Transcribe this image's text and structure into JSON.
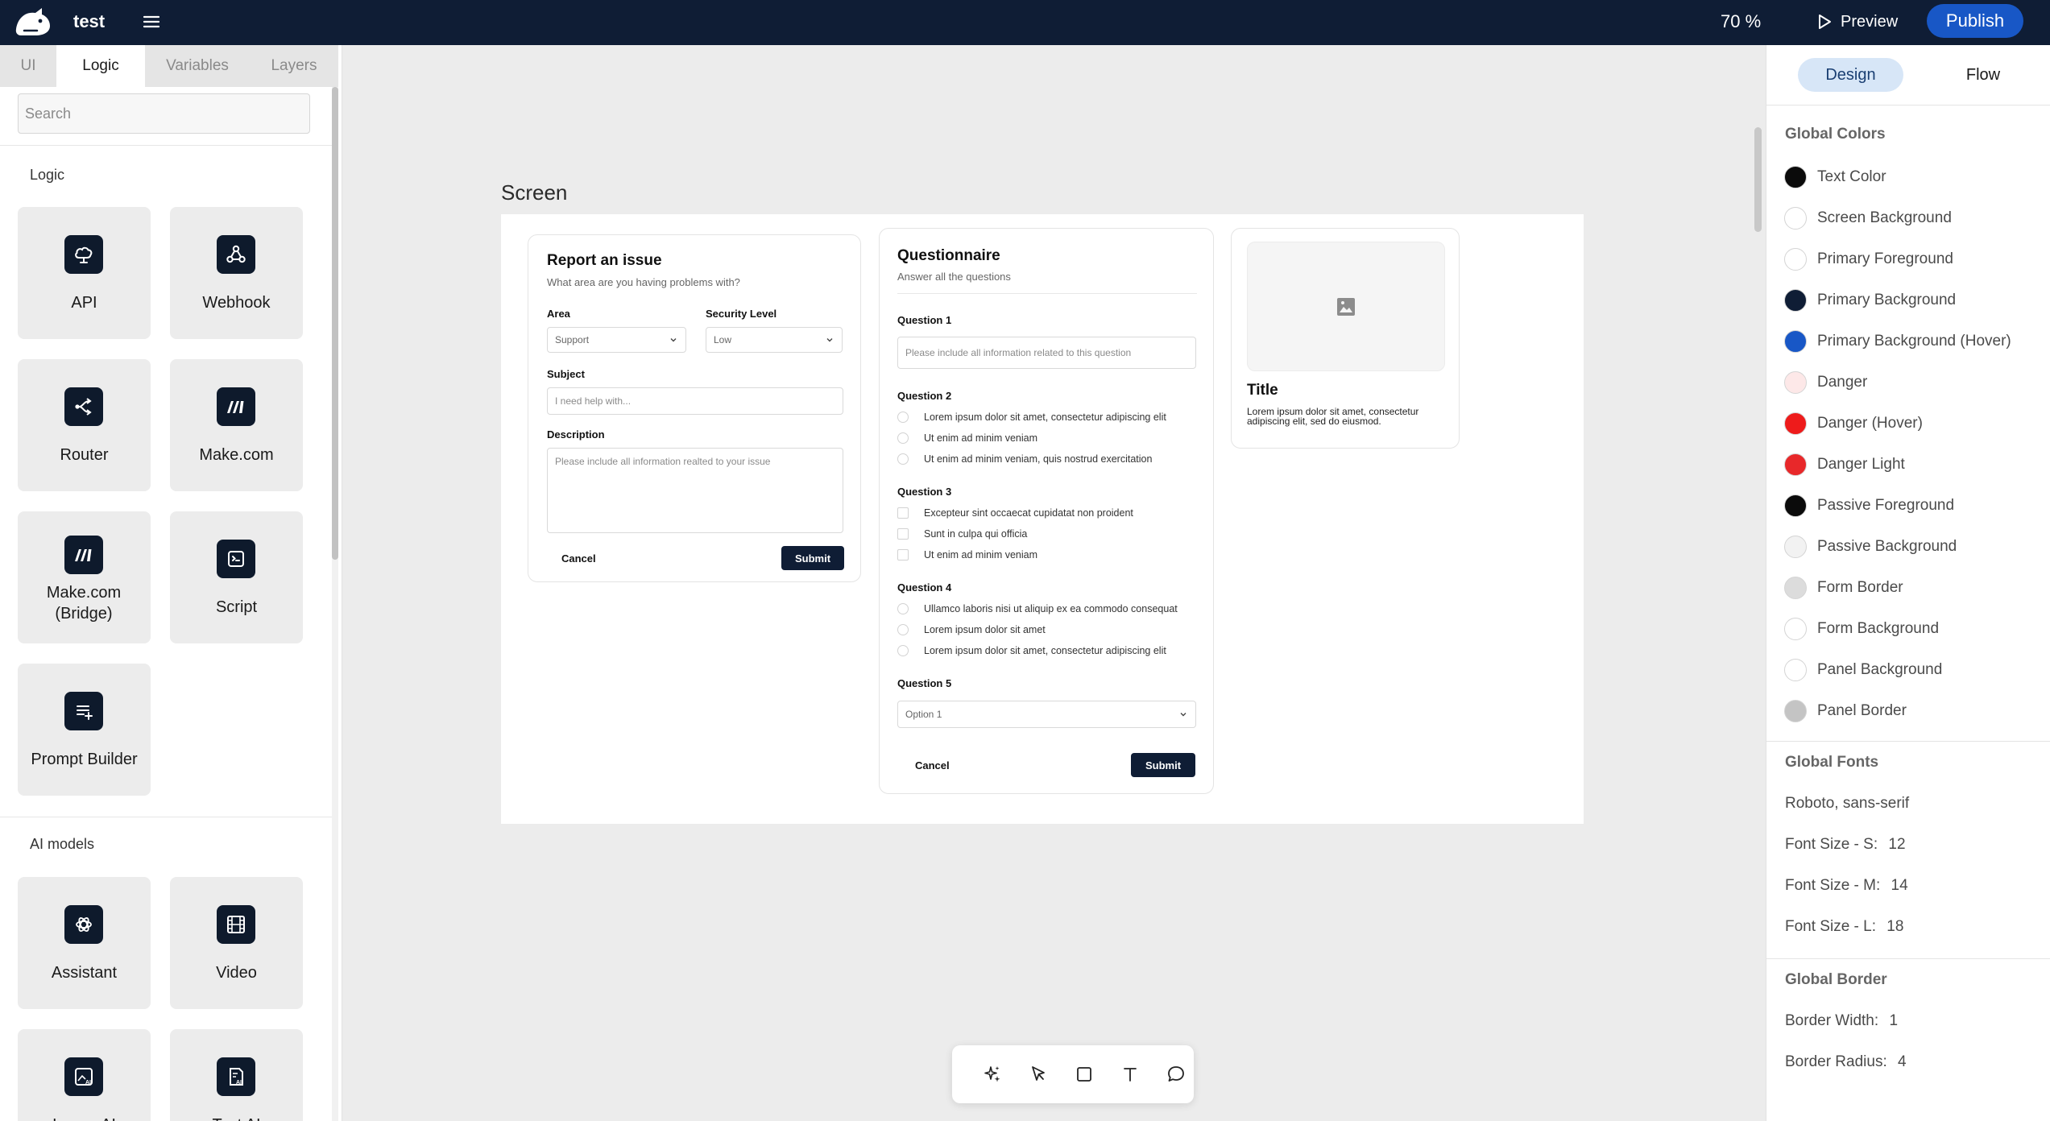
{
  "app": {
    "name": "test"
  },
  "topbar": {
    "zoom": "70 %",
    "preview_label": "Preview",
    "publish_label": "Publish"
  },
  "left_panel": {
    "tabs": [
      {
        "label": "UI",
        "active": false
      },
      {
        "label": "Logic",
        "active": true
      },
      {
        "label": "Variables",
        "active": false
      },
      {
        "label": "Layers",
        "active": false
      }
    ],
    "search": {
      "placeholder": "Search",
      "value": ""
    },
    "sections": [
      {
        "title": "Logic",
        "items": [
          {
            "label": "API",
            "icon": "api-cloud-icon"
          },
          {
            "label": "Webhook",
            "icon": "webhook-icon"
          },
          {
            "label": "Router",
            "icon": "router-icon"
          },
          {
            "label": "Make.com",
            "icon": "make-logo-icon"
          },
          {
            "label": "Make.com (Bridge)",
            "icon": "make-logo-icon"
          },
          {
            "label": "Script",
            "icon": "script-icon"
          },
          {
            "label": "Prompt Builder",
            "icon": "prompt-builder-icon"
          }
        ]
      },
      {
        "title": "AI models",
        "items": [
          {
            "label": "Assistant",
            "icon": "openai-icon"
          },
          {
            "label": "Video",
            "icon": "film-icon"
          },
          {
            "label": "Image AI",
            "icon": "image-ai-icon"
          },
          {
            "label": "Text AI",
            "icon": "text-ai-icon"
          }
        ]
      }
    ]
  },
  "canvas": {
    "screen_label": "Screen",
    "report_form": {
      "title": "Report an issue",
      "subtitle": "What area are you having problems with?",
      "area_label": "Area",
      "area_value": "Support",
      "security_label": "Security Level",
      "security_value": "Low",
      "subject_label": "Subject",
      "subject_placeholder": "I need help with...",
      "description_label": "Description",
      "description_placeholder": "Please include all information realted to your issue",
      "cancel_label": "Cancel",
      "submit_label": "Submit"
    },
    "questionnaire": {
      "title": "Questionnaire",
      "subtitle": "Answer all the questions",
      "q1_label": "Question 1",
      "q1_placeholder": "Please include all information related to this question",
      "q2_label": "Question 2",
      "q2_options": [
        "Lorem ipsum dolor sit amet, consectetur adipiscing elit",
        "Ut enim ad minim veniam",
        "Ut enim ad minim veniam, quis nostrud exercitation"
      ],
      "q3_label": "Question 3",
      "q3_options": [
        "Excepteur sint occaecat cupidatat non proident",
        "Sunt in culpa qui officia",
        "Ut enim ad minim veniam"
      ],
      "q4_label": "Question 4",
      "q4_options": [
        "Ullamco laboris nisi ut aliquip ex ea commodo consequat",
        "Lorem ipsum dolor sit amet",
        "Lorem ipsum dolor sit amet, consectetur adipiscing elit"
      ],
      "q5_label": "Question 5",
      "q5_value": "Option 1",
      "cancel_label": "Cancel",
      "submit_label": "Submit"
    },
    "card": {
      "title": "Title",
      "body": "Lorem ipsum dolor sit amet, consectetur adipiscing elit, sed do eiusmod."
    }
  },
  "toolbar": {
    "tools": [
      "ai-sparkle-icon",
      "pointer-icon",
      "rectangle-icon",
      "text-icon",
      "comment-icon"
    ]
  },
  "right_panel": {
    "segments": [
      {
        "label": "Design",
        "active": true
      },
      {
        "label": "Flow",
        "active": false
      }
    ],
    "global_colors_title": "Global Colors",
    "colors": [
      {
        "label": "Text Color",
        "color": "#0b0b0b"
      },
      {
        "label": "Screen Background",
        "color": "#ffffff"
      },
      {
        "label": "Primary Foreground",
        "color": "#ffffff"
      },
      {
        "label": "Primary Background",
        "color": "#0f1d35"
      },
      {
        "label": "Primary Background (Hover)",
        "color": "#1857c6"
      },
      {
        "label": "Danger",
        "color": "#fde8e8"
      },
      {
        "label": "Danger (Hover)",
        "color": "#ee1b1b"
      },
      {
        "label": "Danger Light",
        "color": "#e8282a"
      },
      {
        "label": "Passive Foreground",
        "color": "#0b0b0b"
      },
      {
        "label": "Passive Background",
        "color": "#f2f2f2"
      },
      {
        "label": "Form Border",
        "color": "#dcdcdc"
      },
      {
        "label": "Form Background",
        "color": "#ffffff"
      },
      {
        "label": "Panel Background",
        "color": "#ffffff"
      },
      {
        "label": "Panel Border",
        "color": "#c4c4c4"
      }
    ],
    "global_fonts_title": "Global Fonts",
    "font_family": "Roboto, sans-serif",
    "font_sizes": [
      {
        "label": "Font Size - S:",
        "value": "12"
      },
      {
        "label": "Font Size - M:",
        "value": "14"
      },
      {
        "label": "Font Size - L:",
        "value": "18"
      }
    ],
    "global_border_title": "Global Border",
    "border_width": {
      "label": "Border Width:",
      "value": "1"
    },
    "border_radius": {
      "label": "Border Radius:",
      "value": "4"
    }
  }
}
